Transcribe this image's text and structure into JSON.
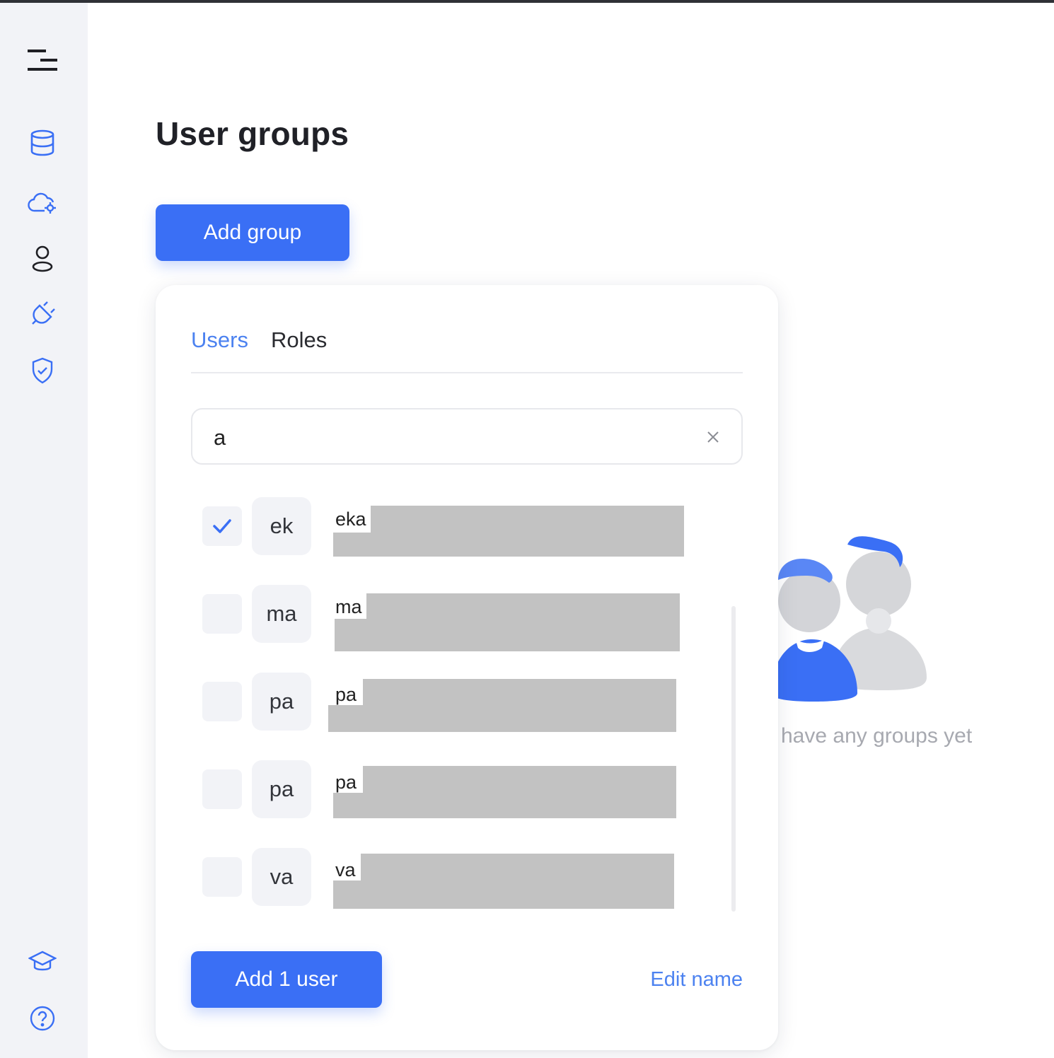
{
  "page": {
    "title": "User groups"
  },
  "actions": {
    "add_group_label": "Add group"
  },
  "sidebar": {
    "items": [
      {
        "icon": "menu-icon"
      },
      {
        "icon": "database-icon"
      },
      {
        "icon": "cloud-settings-icon"
      },
      {
        "icon": "user-icon"
      },
      {
        "icon": "plug-icon"
      },
      {
        "icon": "shield-check-icon"
      },
      {
        "icon": "graduation-cap-icon"
      },
      {
        "icon": "help-icon"
      }
    ]
  },
  "panel": {
    "tabs": [
      {
        "label": "Users",
        "active": true
      },
      {
        "label": "Roles",
        "active": false
      }
    ],
    "search": {
      "value": "a"
    },
    "users": [
      {
        "initials": "ek",
        "name_visible": "eka",
        "checked": true
      },
      {
        "initials": "ma",
        "name_visible": "ma",
        "checked": false
      },
      {
        "initials": "pa",
        "name_visible": "pa",
        "checked": false
      },
      {
        "initials": "pa",
        "name_visible": "pa",
        "checked": false
      },
      {
        "initials": "va",
        "name_visible": "va",
        "checked": false
      }
    ],
    "add_user_label": "Add 1 user",
    "edit_name_label": "Edit name"
  },
  "empty_state": {
    "text": "have any groups yet"
  },
  "colors": {
    "accent": "#3a6ff5",
    "link": "#4c82f0",
    "sidebar_bg": "#f2f3f7"
  }
}
